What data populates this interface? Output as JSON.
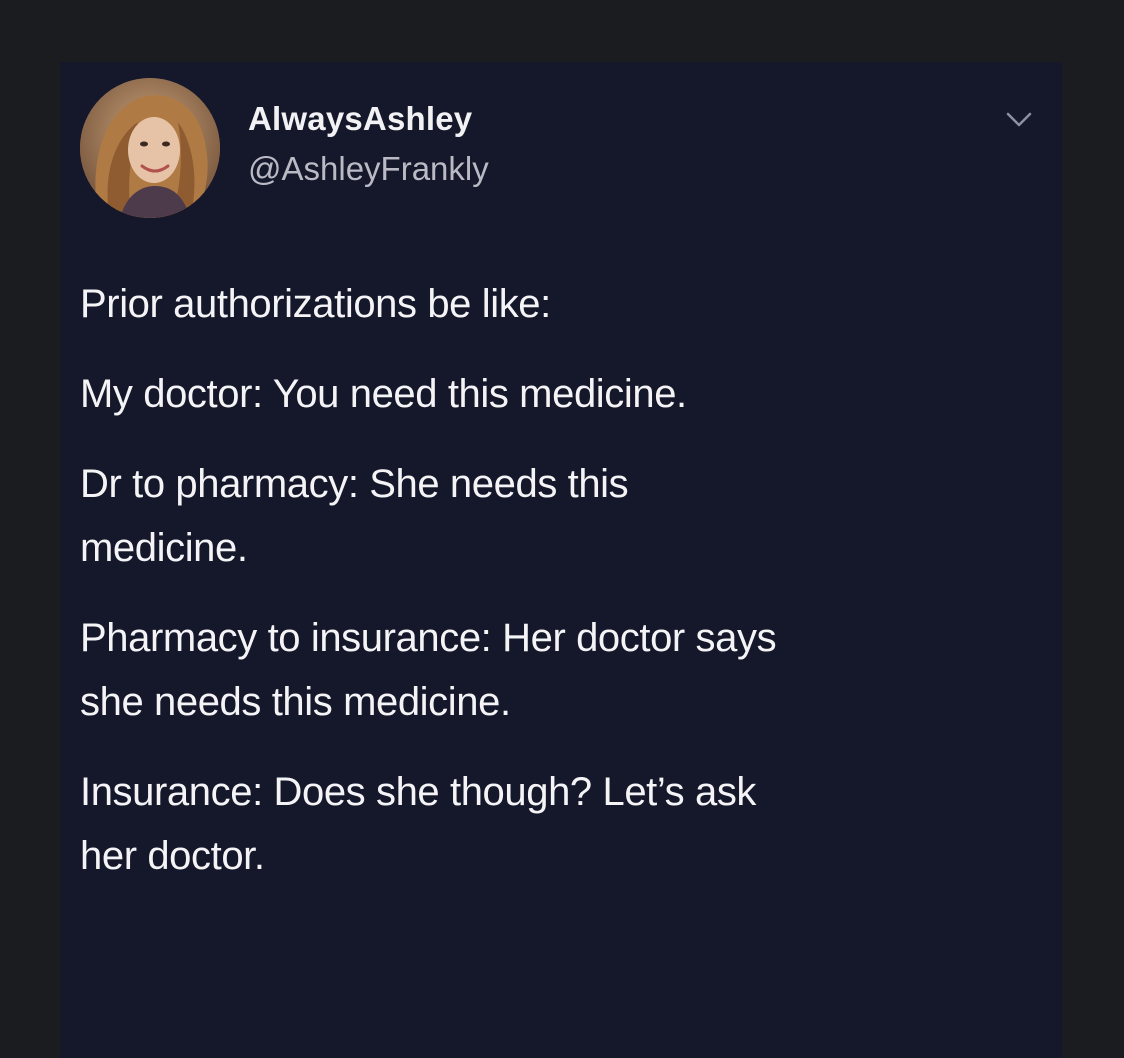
{
  "tweet": {
    "display_name": "AlwaysAshley",
    "handle": "@AshleyFrankly",
    "avatar_icon": "profile-photo",
    "menu_icon": "chevron-down-icon",
    "paragraphs": [
      "Prior authorizations be like:",
      "My doctor: You need this medicine.",
      "Dr to pharmacy: She needs this\nmedicine.",
      "Pharmacy to insurance: Her doctor says\nshe needs this medicine.",
      "Insurance: Does she though? Let’s ask\nher doctor."
    ]
  },
  "colors": {
    "background": "#15172a",
    "text": "#f4f4f6",
    "secondary_text": "#b9bac4"
  }
}
